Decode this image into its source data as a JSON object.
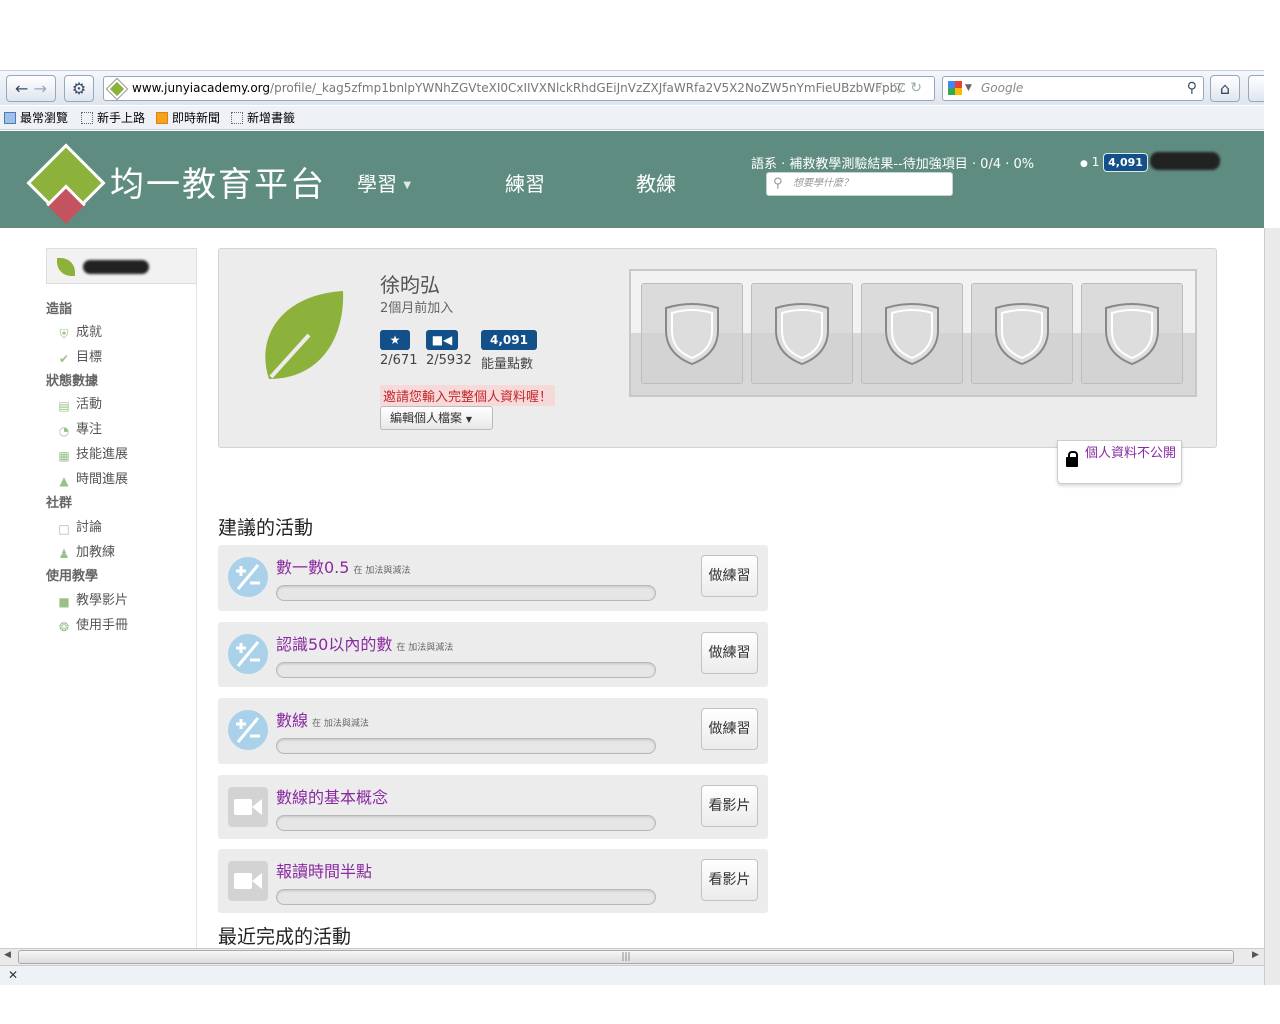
{
  "browser": {
    "url_domain": "www.junyiacademy.org",
    "url_path": "/profile/_kag5zfmp1bnlpYWNhZGVteXI0CxIIVXNlckRhdGEiJnVzZXJfaWRfa2V5X2NoZW5nYmFieUBzbWFpbC",
    "search_placeholder": "Google",
    "bookmarks": [
      "最常瀏覽",
      "新手上路",
      "即時新聞",
      "新增書籤"
    ]
  },
  "header": {
    "brand": "均一教育平台",
    "nav": [
      "學習",
      "練習",
      "教練"
    ],
    "breadcrumb": "語系 · 補救教學測驗結果--待加強項目 · 0/4 · 0%",
    "search_placeholder": "想要學什麼？",
    "streak": "1",
    "points": "4,091"
  },
  "sidebar": {
    "sections": [
      {
        "title": "造詣",
        "items": [
          "成就",
          "目標"
        ]
      },
      {
        "title": "狀態數據",
        "items": [
          "活動",
          "專注",
          "技能進展",
          "時間進展"
        ]
      },
      {
        "title": "社群",
        "items": [
          "討論",
          "加教練"
        ]
      },
      {
        "title": "使用教學",
        "items": [
          "教學影片",
          "使用手冊"
        ]
      }
    ]
  },
  "profile": {
    "name": "徐昀弘",
    "joined": "2個月前加入",
    "points_badge": "4,091",
    "exercises": "2/671",
    "videos": "2/5932",
    "points_label": "能量點數",
    "warning": "邀請您輸入完整個人資料喔！",
    "edit_label": "編輯個人檔案",
    "privacy": "個人資料不公開"
  },
  "suggested": {
    "title": "建議的活動",
    "items": [
      {
        "title": "數一數0.5",
        "in": "在 加法與減法",
        "button": "做練習",
        "type": "exercise"
      },
      {
        "title": "認識50以內的數",
        "in": "在 加法與減法",
        "button": "做練習",
        "type": "exercise"
      },
      {
        "title": "數線",
        "in": "在 加法與減法",
        "button": "做練習",
        "type": "exercise"
      },
      {
        "title": "數線的基本概念",
        "in": "",
        "button": "看影片",
        "type": "video"
      },
      {
        "title": "報讀時間半點",
        "in": "",
        "button": "看影片",
        "type": "video"
      }
    ]
  },
  "recent": {
    "title": "最近完成的活動"
  },
  "colors": {
    "header_bg": "#5f8c80",
    "accent_purple": "#8a2aa0",
    "badge_blue": "#13508a",
    "leaf_green": "#8db23b"
  }
}
